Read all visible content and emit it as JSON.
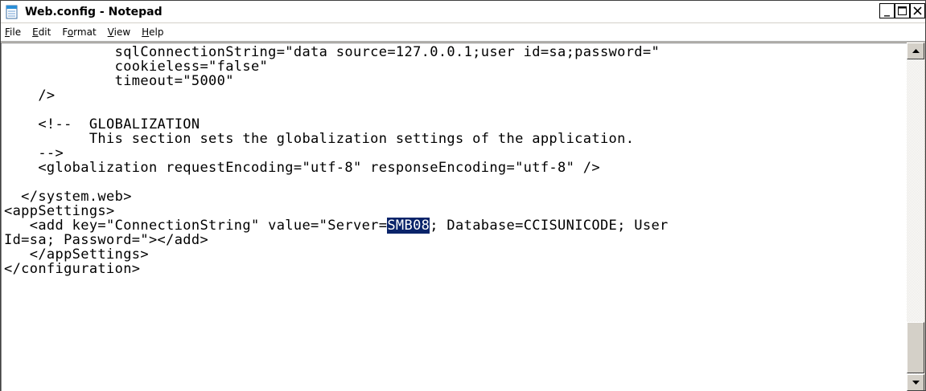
{
  "window": {
    "title": "Web.config - Notepad",
    "icon": "notepad-icon",
    "buttons": {
      "minimize": "_",
      "maximize": "□",
      "close": "×"
    }
  },
  "menu": {
    "file": {
      "mnemonic": "F",
      "rest": "ile"
    },
    "edit": {
      "mnemonic": "E",
      "rest": "dit"
    },
    "format": {
      "pre": "F",
      "mnemonic": "o",
      "rest": "rmat"
    },
    "view": {
      "mnemonic": "V",
      "rest": "iew"
    },
    "help": {
      "mnemonic": "H",
      "rest": "elp"
    }
  },
  "editor": {
    "lines": [
      "             sqlConnectionString=\"data source=127.0.0.1;user id=sa;password=\"",
      "             cookieless=\"false\"",
      "             timeout=\"5000\"",
      "    />",
      "",
      "    <!--  GLOBALIZATION",
      "          This section sets the globalization settings of the application.",
      "    -->",
      "    <globalization requestEncoding=\"utf-8\" responseEncoding=\"utf-8\" />",
      "",
      "  </system.web>",
      "<appSettings>",
      "   <add key=\"ConnectionString\" value=\"Server=",
      "Id=sa; Password=\"></add>",
      "   </appSettings>",
      "</configuration>"
    ],
    "selected_text": "SMB08",
    "after_selection": "; Database=CCISUNICODE; User",
    "selection_color": "#0a246a"
  },
  "scrollbar": {
    "up_icon": "scroll-up-arrow-icon",
    "down_icon": "scroll-down-arrow-icon"
  }
}
